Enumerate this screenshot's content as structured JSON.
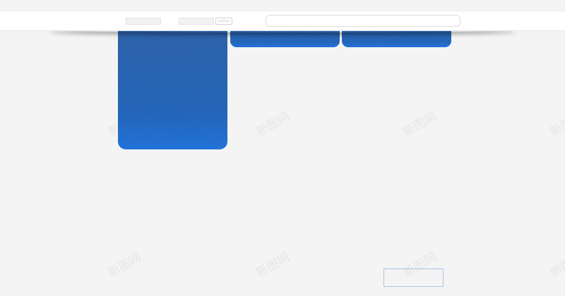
{
  "header": {
    "search": {
      "value": "",
      "placeholder": ""
    }
  },
  "tabs": [
    {
      "id": "tab-1",
      "label": ""
    },
    {
      "id": "tab-2",
      "label": ""
    },
    {
      "id": "tab-3",
      "label": ""
    }
  ],
  "watermark": {
    "text": "新图网"
  },
  "footer": {
    "button_label": ""
  },
  "colors": {
    "background": "#f4f4f4",
    "tab_blue": "#1f63b8",
    "tab_blue_bottom": "#1d6fd8",
    "header_bg": "#ffffff",
    "button_border": "#a9c4e4"
  }
}
